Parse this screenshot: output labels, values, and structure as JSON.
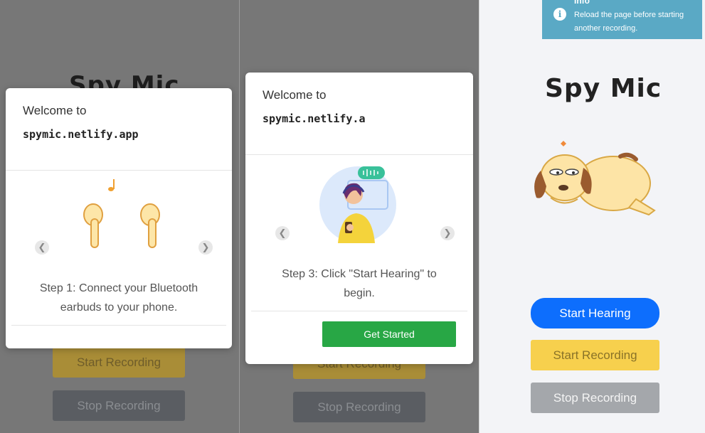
{
  "app": {
    "title": "Spy Mic"
  },
  "buttons": {
    "start_hearing": "Start Hearing",
    "start_recording": "Start Recording",
    "stop_recording": "Stop Recording",
    "get_started": "Get Started"
  },
  "modal_1": {
    "welcome": "Welcome to",
    "domain": "spymic.netlify.app",
    "step_text": "Step 1: Connect your Bluetooth earbuds to your phone.",
    "illustration": "earbuds-illustration"
  },
  "modal_2": {
    "welcome": "Welcome to",
    "domain": "spymic.netlify.a",
    "step_text": "Step 3: Click \"Start Hearing\" to begin.",
    "illustration": "person-listening-illustration"
  },
  "toast": {
    "title": "Info",
    "message": "Reload the page before starting another recording.",
    "icon": "info-icon"
  },
  "icons": {
    "prev": "chevron-left-icon",
    "next": "chevron-right-icon"
  },
  "colors": {
    "primary": "#0d6efd",
    "warning": "#f7d04d",
    "secondary": "#a4a7ab",
    "success": "#28a745",
    "info": "#5aa9c5"
  }
}
